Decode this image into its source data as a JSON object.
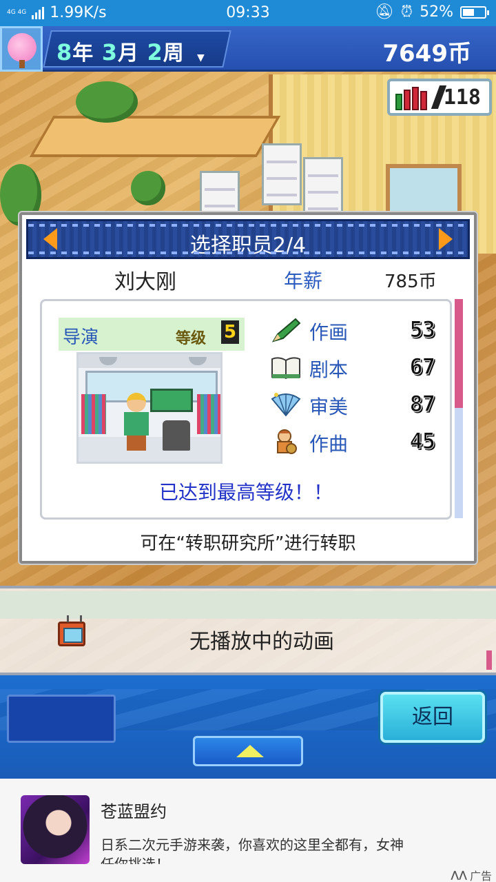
{
  "status_bar": {
    "network": "4G 4G",
    "speed": "1.99K/s",
    "time": "09:33",
    "battery": "52%",
    "battery_level": 0.52,
    "icons": [
      "mute-icon",
      "alarm-icon",
      "battery-icon"
    ]
  },
  "hud": {
    "year": "8",
    "year_unit": "年",
    "month": "3",
    "month_unit": "月",
    "week": "2",
    "week_unit": "周",
    "dropdown_icon": "chevron-down-icon",
    "money": "7649币",
    "research_points": "118"
  },
  "dialog": {
    "title": "选择职员2/4",
    "employee_name": "刘大刚",
    "salary_label": "年薪",
    "salary_value": "785币",
    "job": "导演",
    "level_label": "等级",
    "level_value": "5",
    "stats": [
      {
        "name": "作画",
        "value": "53",
        "icon": "pencil-icon"
      },
      {
        "name": "剧本",
        "value": "67",
        "icon": "book-icon"
      },
      {
        "name": "审美",
        "value": "87",
        "icon": "fan-icon"
      },
      {
        "name": "作曲",
        "value": "45",
        "icon": "guitar-icon"
      }
    ],
    "max_level_msg": "已达到最高等级！！",
    "footnote": "可在“转职研究所”进行转职"
  },
  "animation_bar": {
    "text": "无播放中的动画",
    "icon": "tv-icon"
  },
  "controls": {
    "back_label": "返回",
    "up_icon": "up-triangle-icon"
  },
  "ad": {
    "title": "苍蓝盟约",
    "description": "日系二次元手游来袭，你喜欢的这里全都有，女神任你挑选！",
    "tag": "广告"
  },
  "colors": {
    "hud_blue": "#2650b0",
    "accent_orange": "#ff9a1a",
    "stat_label_blue": "#2a58b8",
    "max_level_blue": "#2232c8",
    "scroll_pink": "#d85a8a",
    "back_button_cyan": "#2ab0d8"
  }
}
